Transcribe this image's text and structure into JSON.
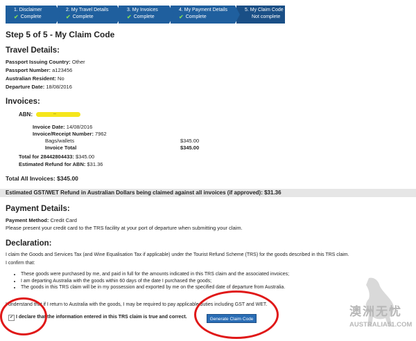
{
  "steps": [
    {
      "label": "1. Disclaimer",
      "status": "Complete"
    },
    {
      "label": "2. My Travel Details",
      "status": "Complete"
    },
    {
      "label": "3. My Invoices",
      "status": "Complete"
    },
    {
      "label": "4. My Payment Details",
      "status": "Complete"
    },
    {
      "label": "5. My Claim Code",
      "status": "Not complete"
    }
  ],
  "page_title": "Step 5 of 5 - My Claim Code",
  "travel": {
    "heading": "Travel Details:",
    "country_label": "Passport Issuing Country:",
    "country": "Other",
    "passport_label": "Passport Number:",
    "passport": "a123456",
    "resident_label": "Australian Resident:",
    "resident": "No",
    "departure_label": "Departure Date:",
    "departure": "18/08/2016"
  },
  "invoices": {
    "heading": "Invoices:",
    "abn_label": "ABN:",
    "abn_value": "..",
    "date_label": "Invoice Date:",
    "date": "14/08/2016",
    "receipt_label": "Invoice/Receipt Number:",
    "receipt": "7962",
    "item": "Bags/wallets",
    "item_amount": "$345.00",
    "total_label": "Invoice Total",
    "total_amount": "$345.00",
    "total_for_label": "Total for 28442804433:",
    "total_for": "$345.00",
    "refund_label": "Estimated Refund for ABN:",
    "refund": "$31.36",
    "all_label": "Total All Invoices:",
    "all_amount": "$345.00"
  },
  "estimated_line": "Estimated GST/WET Refund in Australian Dollars being claimed against all invoices (if approved): $31.36",
  "payment": {
    "heading": "Payment Details:",
    "method_label": "Payment Method:",
    "method": "Credit Card",
    "note": "Please present your credit card to the TRS facility at your port of departure when submitting your claim."
  },
  "declaration": {
    "heading": "Declaration:",
    "intro": "I claim the Goods and Services Tax (and Wine Equalisation Tax if applicable) under the Tourist Refund Scheme (TRS) for the goods described in this TRS claim.",
    "confirm": "I confirm that:",
    "bullets": [
      "These goods were purchased by me, and paid in full for the amounts indicated in this TRS claim and the associated invoices;",
      "I am departing Australia with the goods within 60 days of the date I purchased the goods;",
      "The goods in this TRS claim will be in my possession and exported by me on the specified date of departure from Australia."
    ],
    "understand": "I understand that if I return to Australia with the goods, I may be required to pay applicable duties including GST and WET.",
    "checkbox_label": "I declare that the information entered in this TRS claim is true and correct.",
    "button": "Generate Claim Code"
  },
  "watermark": {
    "chinese": "澳洲无忧",
    "site": "AUSTRALIA51.COM"
  },
  "colors": {
    "step_bg": "#1f5f9e",
    "check": "#7ed957",
    "button": "#2a6db5",
    "annotation": "#e01818",
    "highlight": "#f5e61c"
  }
}
